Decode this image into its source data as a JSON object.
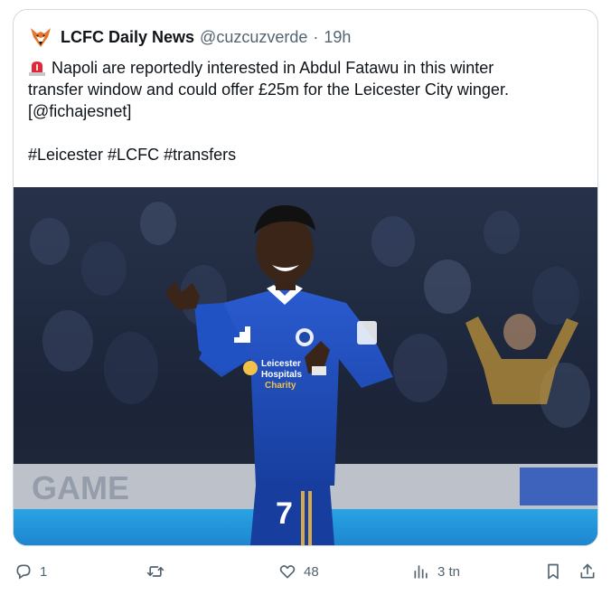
{
  "post": {
    "display_name": "LCFC Daily News",
    "handle": "@cuzcuzverde",
    "separator": "·",
    "time": "19h",
    "text_line1": "Napoli are reportedly interested in Abdul Fatawu in this winter",
    "text_line2": "transfer window and could offer £25m for the Leicester City winger.",
    "text_line3": "[@fichajesnet]",
    "hashtags": "#Leicester #LCFC #transfers",
    "media": {
      "shirt_number": "7",
      "sponsor_line1": "Leicester",
      "sponsor_line2": "Hospitals",
      "sponsor_line3": "Charity",
      "board_text": "GAME"
    }
  },
  "actions": {
    "replies": "1",
    "likes": "48",
    "views": "3 tn"
  },
  "icons": {
    "avatar": "fox-logo-icon",
    "emoji": "siren-icon",
    "reply": "reply-icon",
    "repost": "repost-icon",
    "like": "heart-icon",
    "views": "views-icon",
    "bookmark": "bookmark-icon",
    "share": "share-icon"
  },
  "colors": {
    "text": "#0f1419",
    "secondary": "#536471",
    "border": "#cfd9de",
    "kit_blue": "#1f48a8",
    "fox_orange": "#e8742a"
  }
}
